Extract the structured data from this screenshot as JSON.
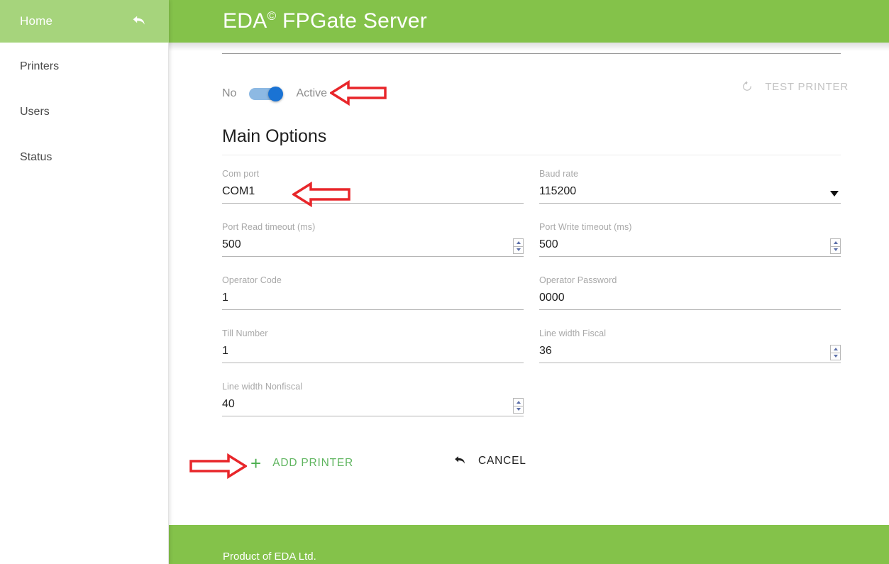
{
  "header": {
    "title_main": "EDA",
    "title_sup": "©",
    "title_rest": " FPGate Server"
  },
  "sidebar": {
    "home": {
      "label": "Home",
      "icon": "back-arrow-icon"
    },
    "items": [
      {
        "label": "Printers"
      },
      {
        "label": "Users"
      },
      {
        "label": "Status"
      }
    ]
  },
  "content": {
    "toggle": {
      "off_label": "No",
      "on_label": "Active",
      "state": "on",
      "track_color": "#8db9e3",
      "knob_color": "#1a73d4"
    },
    "test_printer": {
      "label": "TEST PRINTER",
      "icon": "refresh-icon",
      "disabled": true
    },
    "section_title": "Main Options",
    "fields": [
      {
        "label": "Com port",
        "value": "COM1",
        "control": "text"
      },
      {
        "label": "Baud rate",
        "value": "115200",
        "control": "select"
      },
      {
        "label": "Port Read timeout (ms)",
        "value": "500",
        "control": "spinner"
      },
      {
        "label": "Port Write timeout (ms)",
        "value": "500",
        "control": "spinner"
      },
      {
        "label": "Operator Code",
        "value": "1",
        "control": "text"
      },
      {
        "label": "Operator Password",
        "value": "0000",
        "control": "text"
      },
      {
        "label": "Till Number",
        "value": "1",
        "control": "text"
      },
      {
        "label": "Line width Fiscal",
        "value": "36",
        "control": "spinner"
      },
      {
        "label": "Line width Nonfiscal",
        "value": "40",
        "control": "spinner"
      }
    ],
    "actions": {
      "add_printer": {
        "label": "ADD PRINTER",
        "icon": "plus-icon",
        "color": "#5fb55f"
      },
      "cancel": {
        "label": "CANCEL",
        "icon": "undo-arrow-icon",
        "color": "#1f1f1f"
      }
    }
  },
  "footer": {
    "text": "Product of EDA Ltd."
  },
  "annotations": {
    "color": "#e8262a",
    "arrows": [
      {
        "name": "arrow-pointing-active-toggle",
        "direction": "left"
      },
      {
        "name": "arrow-pointing-com-port",
        "direction": "left"
      },
      {
        "name": "arrow-pointing-add-printer",
        "direction": "right"
      }
    ]
  },
  "theme": {
    "header_green": "#84c24a",
    "sidebar_active_green": "#a6d47c",
    "footer_green": "#84c24a"
  }
}
